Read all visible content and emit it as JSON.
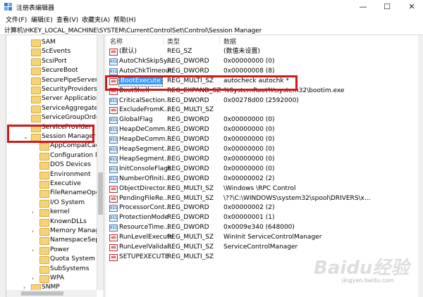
{
  "window": {
    "title": "注册表编辑器",
    "minimize": "—",
    "maximize": "☐",
    "close": "✕"
  },
  "menu": [
    "文件(F)",
    "编辑(E)",
    "查看(V)",
    "收藏夹(A)",
    "帮助(H)"
  ],
  "address": "计算机\\HKEY_LOCAL_MACHINE\\SYSTEM\\CurrentControlSet\\Control\\Session Manager",
  "tree": [
    {
      "label": "SAM",
      "level": 0
    },
    {
      "label": "ScEvents",
      "level": 0
    },
    {
      "label": "ScsiPort",
      "level": 0
    },
    {
      "label": "SecureBoot",
      "level": 0
    },
    {
      "label": "SecurePipeServers",
      "level": 0
    },
    {
      "label": "SecurityProviders",
      "level": 0
    },
    {
      "label": "Server Applications",
      "level": 0
    },
    {
      "label": "ServiceAggregatedE",
      "level": 0
    },
    {
      "label": "ServiceGroupOrder",
      "level": 0
    },
    {
      "label": "ServiceProvider",
      "level": 0
    },
    {
      "label": "Session Manager",
      "level": 0,
      "expanded": true
    },
    {
      "label": "AppCompatCache",
      "level": 1
    },
    {
      "label": "Configuration Ma",
      "level": 1
    },
    {
      "label": "DOS Devices",
      "level": 1
    },
    {
      "label": "Environment",
      "level": 1
    },
    {
      "label": "Executive",
      "level": 1
    },
    {
      "label": "FileRenameOpera",
      "level": 1
    },
    {
      "label": "I/O System",
      "level": 1
    },
    {
      "label": "kernel",
      "level": 1,
      "expandable": true
    },
    {
      "label": "KnownDLLs",
      "level": 1
    },
    {
      "label": "Memory Manager",
      "level": 1,
      "expandable": true
    },
    {
      "label": "NamespaceSepar",
      "level": 1
    },
    {
      "label": "Power",
      "level": 1,
      "expandable": true
    },
    {
      "label": "Quota System",
      "level": 1
    },
    {
      "label": "SubSystems",
      "level": 1
    },
    {
      "label": "WPA",
      "level": 1,
      "expandable": true
    },
    {
      "label": "SNMP",
      "level": 0,
      "expandable": true
    }
  ],
  "columns": {
    "name": "名称",
    "type": "类型",
    "data": "数据"
  },
  "values": [
    {
      "icon": "ab",
      "name": "(默认)",
      "type": "REG_SZ",
      "data": "(数值未设置)"
    },
    {
      "icon": "bin",
      "name": "AutoChkSkipSy...",
      "type": "REG_DWORD",
      "data": "0x00000000 (0)"
    },
    {
      "icon": "bin",
      "name": "AutoChkTimeout",
      "type": "REG_DWORD",
      "data": "0x00000008 (8)"
    },
    {
      "icon": "ab",
      "name": "BootExecute",
      "type": "REG_MULTI_SZ",
      "data": "autocheck autochk *",
      "selected": true
    },
    {
      "icon": "ab",
      "name": "BootShell",
      "type": "REG_EXPAND_SZ",
      "data": "%SystemRoot%\\system32\\bootim.exe"
    },
    {
      "icon": "bin",
      "name": "CriticalSection...",
      "type": "REG_DWORD",
      "data": "0x00278d00 (2592000)"
    },
    {
      "icon": "ab",
      "name": "ExcludeFromK...",
      "type": "REG_MULTI_SZ",
      "data": ""
    },
    {
      "icon": "bin",
      "name": "GlobalFlag",
      "type": "REG_DWORD",
      "data": "0x00000000 (0)"
    },
    {
      "icon": "bin",
      "name": "HeapDeComm...",
      "type": "REG_DWORD",
      "data": "0x00000000 (0)"
    },
    {
      "icon": "bin",
      "name": "HeapDeComm...",
      "type": "REG_DWORD",
      "data": "0x00000000 (0)"
    },
    {
      "icon": "bin",
      "name": "HeapSegment...",
      "type": "REG_DWORD",
      "data": "0x00000000 (0)"
    },
    {
      "icon": "bin",
      "name": "HeapSegment...",
      "type": "REG_DWORD",
      "data": "0x00000000 (0)"
    },
    {
      "icon": "bin",
      "name": "InitConsoleFlags",
      "type": "REG_DWORD",
      "data": "0x00000000 (0)"
    },
    {
      "icon": "bin",
      "name": "NumberOfIniti...",
      "type": "REG_DWORD",
      "data": "0x00000002 (2)"
    },
    {
      "icon": "ab",
      "name": "ObjectDirector...",
      "type": "REG_MULTI_SZ",
      "data": "\\Windows \\RPC Control"
    },
    {
      "icon": "ab",
      "name": "PendingFileRe...",
      "type": "REG_MULTI_SZ",
      "data": "\\??\\C:\\WINDOWS\\system32\\spool\\DRIVERS\\x..."
    },
    {
      "icon": "bin",
      "name": "ProcessorCont...",
      "type": "REG_DWORD",
      "data": "0x00000002 (2)"
    },
    {
      "icon": "bin",
      "name": "ProtectionMode",
      "type": "REG_DWORD",
      "data": "0x00000001 (1)"
    },
    {
      "icon": "bin",
      "name": "ResourceTime...",
      "type": "REG_DWORD",
      "data": "0x0009e340 (648000)"
    },
    {
      "icon": "ab",
      "name": "RunLevelExecute",
      "type": "REG_MULTI_SZ",
      "data": "WinInit ServiceControlManager"
    },
    {
      "icon": "ab",
      "name": "RunLevelValida...",
      "type": "REG_MULTI_SZ",
      "data": "ServiceControlManager"
    },
    {
      "icon": "ab",
      "name": "SETUPEXECUTE",
      "type": "REG_MULTI_SZ",
      "data": ""
    }
  ],
  "icon_labels": {
    "ab": "ab",
    "bin": "011"
  },
  "watermark": {
    "main": "Baidu经验",
    "sub": "jingyan.baidu.com"
  },
  "colors": {
    "highlight": "#d01a1a",
    "selection": "#3399ff",
    "folder": "#f6d37a"
  }
}
